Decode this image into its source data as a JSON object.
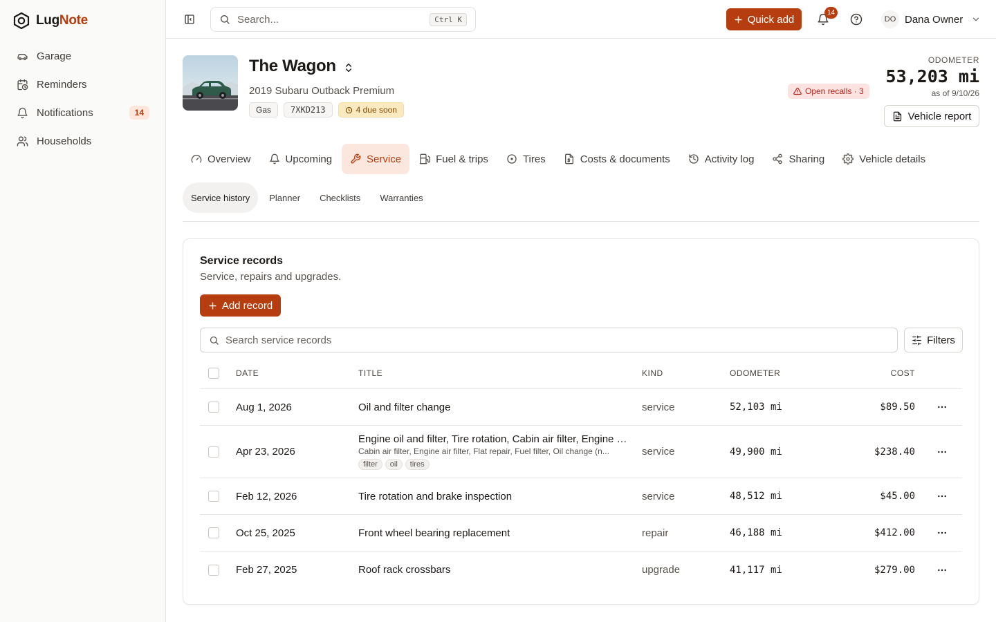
{
  "sidebar": {
    "logo": {
      "part1": "Lug",
      "part2": "Note"
    },
    "items": [
      {
        "label": "Garage",
        "icon": "car-icon"
      },
      {
        "label": "Reminders",
        "icon": "calendar-clock-icon"
      },
      {
        "label": "Notifications",
        "icon": "bell-icon",
        "badge": "14"
      },
      {
        "label": "Households",
        "icon": "users-icon"
      }
    ]
  },
  "topbar": {
    "search_placeholder": "Search...",
    "search_shortcut": "Ctrl K",
    "quick_add": "Quick add",
    "notification_count": "14",
    "user_initials": "DO",
    "user_name": "Dana Owner"
  },
  "vehicle": {
    "name": "The Wagon",
    "subtitle": "2019 Subaru Outback Premium",
    "chips": {
      "fuel": "Gas",
      "plate": "7XKD213",
      "due": "4 due soon"
    },
    "recalls": "Open recalls · 3",
    "odometer_label": "ODOMETER",
    "odometer_value": "53,203 mi",
    "odometer_asof": "as of 9/10/26",
    "report_button": "Vehicle report"
  },
  "tabs": [
    {
      "label": "Overview",
      "active": false
    },
    {
      "label": "Upcoming",
      "active": false
    },
    {
      "label": "Service",
      "active": true
    },
    {
      "label": "Fuel & trips",
      "active": false
    },
    {
      "label": "Tires",
      "active": false
    },
    {
      "label": "Costs & documents",
      "active": false
    },
    {
      "label": "Activity log",
      "active": false
    },
    {
      "label": "Sharing",
      "active": false
    },
    {
      "label": "Vehicle details",
      "active": false
    }
  ],
  "subtabs": [
    {
      "label": "Service history",
      "active": true
    },
    {
      "label": "Planner",
      "active": false
    },
    {
      "label": "Checklists",
      "active": false
    },
    {
      "label": "Warranties",
      "active": false
    }
  ],
  "records": {
    "title": "Service records",
    "description": "Service, repairs and upgrades.",
    "add_button": "Add record",
    "search_placeholder": "Search service records",
    "filters_button": "Filters",
    "columns": {
      "date": "DATE",
      "title": "TITLE",
      "kind": "KIND",
      "odometer": "ODOMETER",
      "cost": "COST"
    },
    "rows": [
      {
        "date": "Aug 1, 2026",
        "title": "Oil and filter change",
        "kind": "service",
        "odometer": "52,103 mi",
        "cost": "$89.50"
      },
      {
        "date": "Apr 23, 2026",
        "title": "Engine oil and filter, Tire rotation, Cabin air filter, Engine air filter, Flat repair, Fuel filter",
        "subtitle": "Cabin air filter, Engine air filter, Flat repair, Fuel filter, Oil change (n...",
        "tags": [
          "filter",
          "oil",
          "tires"
        ],
        "kind": "service",
        "odometer": "49,900 mi",
        "cost": "$238.40"
      },
      {
        "date": "Feb 12, 2026",
        "title": "Tire rotation and brake inspection",
        "kind": "service",
        "odometer": "48,512 mi",
        "cost": "$45.00"
      },
      {
        "date": "Oct 25, 2025",
        "title": "Front wheel bearing replacement",
        "kind": "repair",
        "odometer": "46,188 mi",
        "cost": "$412.00"
      },
      {
        "date": "Feb 27, 2025",
        "title": "Roof rack crossbars",
        "kind": "upgrade",
        "odometer": "41,117 mi",
        "cost": "$279.00"
      }
    ]
  },
  "colors": {
    "accent": "#b53d0f",
    "accent_soft": "#fbe7de",
    "recall": "#b42318",
    "warn": "#7a4b05"
  }
}
